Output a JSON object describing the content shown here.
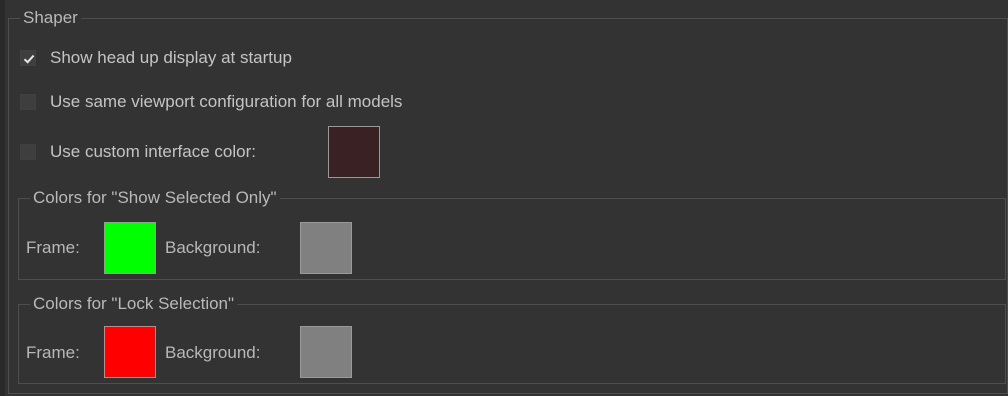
{
  "shaper": {
    "title": "Shaper",
    "options": [
      {
        "label": "Show head up display at startup",
        "checked": true
      },
      {
        "label": "Use same viewport configuration for all models",
        "checked": false
      },
      {
        "label": "Use custom interface color:",
        "checked": false
      }
    ],
    "custom_color": "#3a2224"
  },
  "show_selected_only": {
    "title": "Colors for \"Show Selected Only\"",
    "frame_label": "Frame:",
    "frame_color": "#00ff00",
    "background_label": "Background:",
    "background_color": "#808080"
  },
  "lock_selection": {
    "title": "Colors for \"Lock Selection\"",
    "frame_label": "Frame:",
    "frame_color": "#ff0000",
    "background_label": "Background:",
    "background_color": "#808080"
  }
}
